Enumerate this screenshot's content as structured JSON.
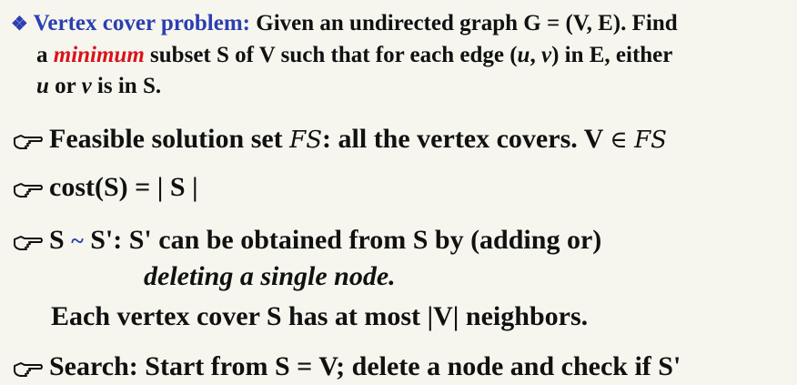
{
  "intro": {
    "marker": "❖",
    "title": "Vertex cover problem:",
    "line1_rest": "Given an undirected graph G = (V, E).  Find",
    "line2_a": "a",
    "line2_emph": "minimum",
    "line2_b": "subset S of  V such that for each edge (",
    "line2_u": "u",
    "line2_comma": ",",
    "line2_v": "v",
    "line2_c": ") in E, either",
    "line3_u": "u",
    "line3_or": "or",
    "line3_v": "v",
    "line3_rest": " is in S."
  },
  "bullets": {
    "b1_a": "Feasible solution set",
    "b1_fs": "FS",
    "b1_b": ": all the vertex covers.  V",
    "b1_in": "∈",
    "b1_fs2": "FS",
    "b2": "cost(S) = | S |",
    "b3_a": "S",
    "b3_tilde": "~",
    "b3_b": "S': S' can be obtained from S by (adding or)",
    "b3_line2": "deleting a single node.",
    "b3_line3": "Each vertex cover S has at most |V| neighbors.",
    "b4": "Search: Start from S = V; delete a node and check if S'"
  },
  "icons": {
    "bullet": "pointing-hand-icon",
    "intro_marker": "diamond-icon"
  },
  "colors": {
    "accent_blue": "#2b3fb0",
    "emphasis_red": "#d8131a",
    "background": "#f6f6ef"
  }
}
